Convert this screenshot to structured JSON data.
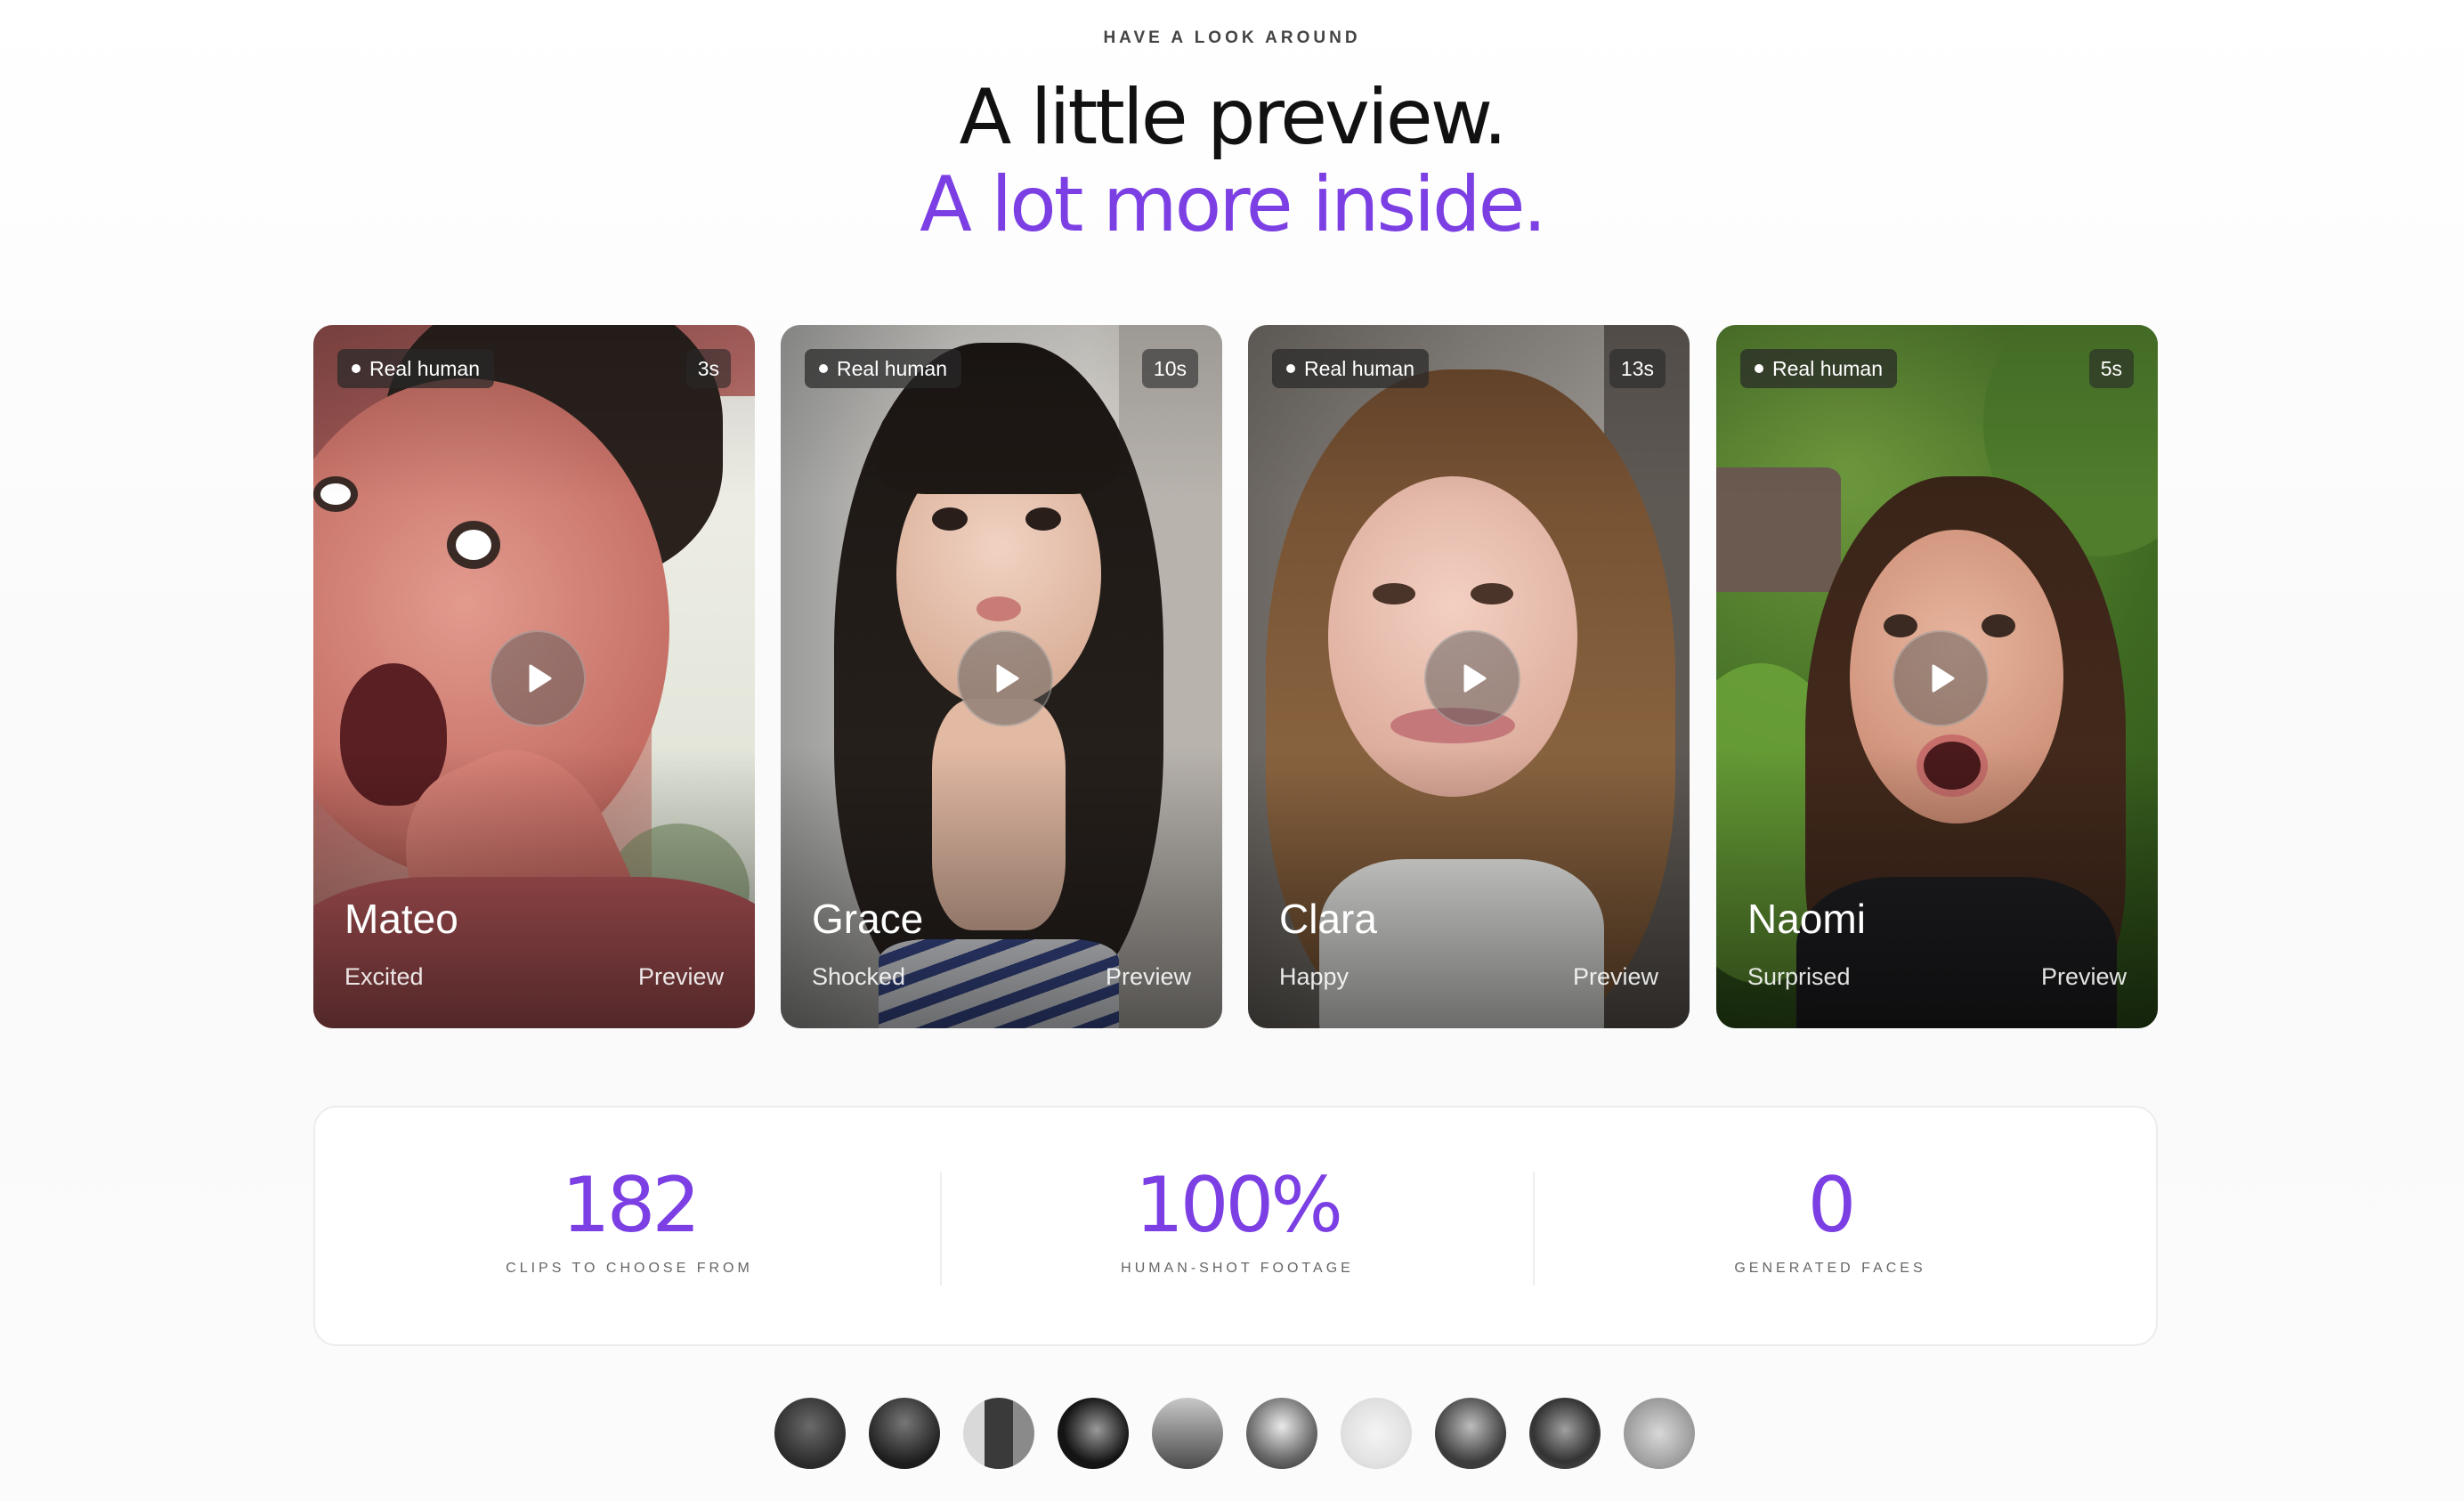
{
  "header": {
    "eyebrow": "HAVE A LOOK AROUND",
    "headline_line1": "A little preview.",
    "headline_line2": "A lot more inside."
  },
  "colors": {
    "accent": "#7b3fe4",
    "text": "#111111"
  },
  "cards": [
    {
      "badge": "Real human",
      "duration": "3s",
      "name": "Mateo",
      "mood": "Excited",
      "preview_label": "Preview"
    },
    {
      "badge": "Real human",
      "duration": "10s",
      "name": "Grace",
      "mood": "Shocked",
      "preview_label": "Preview"
    },
    {
      "badge": "Real human",
      "duration": "13s",
      "name": "Clara",
      "mood": "Happy",
      "preview_label": "Preview"
    },
    {
      "badge": "Real human",
      "duration": "5s",
      "name": "Naomi",
      "mood": "Surprised",
      "preview_label": "Preview"
    }
  ],
  "stats": [
    {
      "value": "182",
      "label": "CLIPS TO CHOOSE FROM"
    },
    {
      "value": "100%",
      "label": "HUMAN-SHOT FOOTAGE"
    },
    {
      "value": "0",
      "label": "GENERATED FACES"
    }
  ],
  "icons": {
    "play": "play-icon",
    "badge_dot": "dot-icon"
  }
}
